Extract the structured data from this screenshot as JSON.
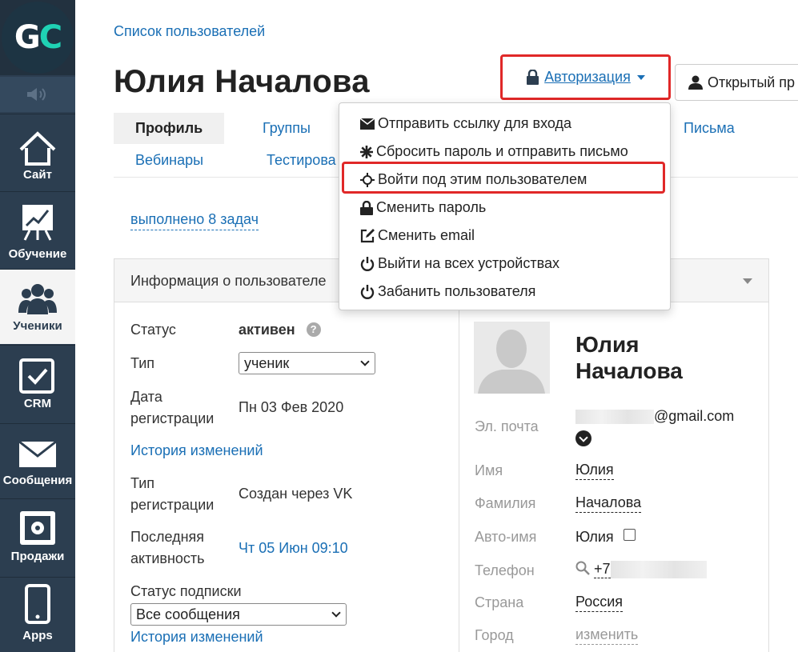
{
  "sidebar": {
    "logo": {
      "g": "G",
      "c": "C"
    },
    "items": [
      {
        "label": "Сайт",
        "icon": "house-icon"
      },
      {
        "label": "Обучение",
        "icon": "chart-board-icon"
      },
      {
        "label": "Ученики",
        "icon": "users-icon"
      },
      {
        "label": "CRM",
        "icon": "checkbox-icon"
      },
      {
        "label": "Сообщения",
        "icon": "envelope-icon"
      },
      {
        "label": "Продажи",
        "icon": "safe-icon"
      },
      {
        "label": "Apps",
        "icon": "phone-icon"
      }
    ],
    "active": "Ученики"
  },
  "breadcrumb": "Список пользователей",
  "page_title": "Юлия Началова",
  "header": {
    "auth_label": "Авторизация",
    "open_label": "Открытый пр"
  },
  "tabs": {
    "profile": "Профиль",
    "groups": "Группы",
    "letters": "Письма",
    "webinars": "Вебинары",
    "tests": "Тестирова"
  },
  "tasks_link": "выполнено 8 задач",
  "panel": {
    "title": "Информация о пользователе",
    "status_label": "Статус",
    "status_value": "активен",
    "help": "?",
    "type_label": "Тип",
    "type_value": "ученик",
    "reg_date_label": "Дата регистрации",
    "reg_date_value": "Пн 03 Фев 2020",
    "history_link_1": "История изменений",
    "reg_type_label": "Тип регистрации",
    "reg_type_value": "Создан через VK",
    "last_activity_label": "Последняя активность",
    "last_activity_value": "Чт 05 Июн 09:10",
    "subscription_label": "Статус подписки",
    "subscription_value": "Все сообщения",
    "history_link_2": "История изменений"
  },
  "profile_card": {
    "name": "Юлия Началова",
    "email_label": "Эл. почта",
    "email_suffix": "@gmail.com",
    "first_name_label": "Имя",
    "first_name": "Юлия",
    "last_name_label": "Фамилия",
    "last_name": "Началова",
    "auto_name_label": "Авто-имя",
    "auto_name": "Юлия",
    "phone_label": "Телефон",
    "phone_prefix": "+7",
    "country_label": "Страна",
    "country": "Россия",
    "city_label": "Город",
    "city_action": "изменить"
  },
  "dropdown": {
    "items": [
      {
        "label": "Отправить ссылку для входа",
        "icon": "envelope-icon"
      },
      {
        "label": "Сбросить пароль и отправить письмо",
        "icon": "asterisk-icon"
      },
      {
        "label": "Войти под этим пользователем",
        "icon": "crosshair-icon"
      },
      {
        "label": "Сменить пароль",
        "icon": "lock-icon"
      },
      {
        "label": "Сменить email",
        "icon": "edit-icon"
      },
      {
        "label": "Выйти на всех устройствах",
        "icon": "power-icon"
      },
      {
        "label": "Забанить пользователя",
        "icon": "power-icon"
      }
    ]
  },
  "colors": {
    "link": "#1a6fb5",
    "highlight": "#e02828",
    "sidebar": "#2c3e50",
    "logo_accent": "#1fd2b4"
  }
}
